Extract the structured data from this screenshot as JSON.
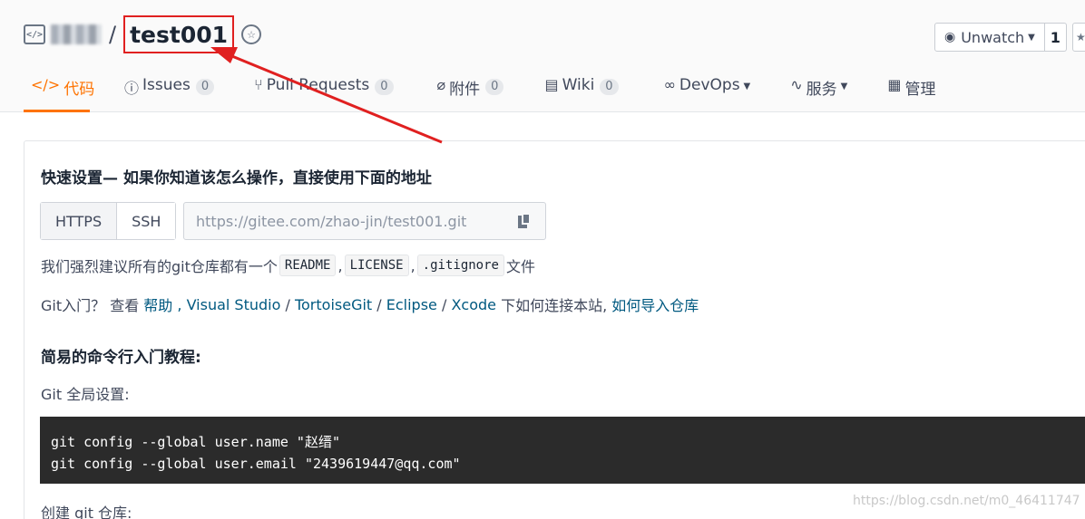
{
  "repo": {
    "separator": "/",
    "name": "test001"
  },
  "watch": {
    "label": "Unwatch",
    "count": "1"
  },
  "tabs": [
    {
      "label": "代码",
      "icon": "code-icon"
    },
    {
      "label": "Issues",
      "count": "0",
      "icon": "info-circle-icon"
    },
    {
      "label": "Pull Requests",
      "count": "0",
      "icon": "pull-request-icon"
    },
    {
      "label": "附件",
      "count": "0",
      "icon": "paperclip-icon"
    },
    {
      "label": "Wiki",
      "count": "0",
      "icon": "book-icon"
    },
    {
      "label": "DevOps",
      "icon": "infinity-icon"
    },
    {
      "label": "服务",
      "icon": "pulse-icon"
    },
    {
      "label": "管理",
      "icon": "clipboard-icon"
    }
  ],
  "quick_setup": {
    "title": "快速设置— 如果你知道该怎么操作，直接使用下面的地址",
    "protocols": [
      "HTTPS",
      "SSH"
    ],
    "url": "https://gitee.com/zhao-jin/test001.git",
    "recommend_prefix": "我们强烈建议所有的git仓库都有一个",
    "files": [
      "README",
      "LICENSE",
      ".gitignore"
    ],
    "comma": ",",
    "recommend_suffix": "文件"
  },
  "git_intro": {
    "prefix": "Git入门？ 查看 ",
    "help": "帮助",
    "sep1": " , ",
    "visual_studio": "Visual Studio",
    "slash1": " / ",
    "tortoise": "TortoiseGit",
    "slash2": " / ",
    "eclipse": "Eclipse",
    "slash3": " / ",
    "xcode": "Xcode",
    "mid": " 下如何连接本站, ",
    "import": "如何导入仓库"
  },
  "tutorial": {
    "title": "简易的命令行入门教程:",
    "global_setup": "Git 全局设置:",
    "commands": [
      "git config --global user.name \"赵缙\"",
      "git config --global user.email \"2439619447@qq.com\""
    ],
    "create_repo": "创建 git 仓库:"
  },
  "watermark": "https://blog.csdn.net/m0_46411747",
  "colors": {
    "accent": "#fe7300",
    "highlight_box": "#e02020",
    "arrow": "#e02020",
    "link": "#005980",
    "terminal_bg": "#2b2b2b"
  }
}
